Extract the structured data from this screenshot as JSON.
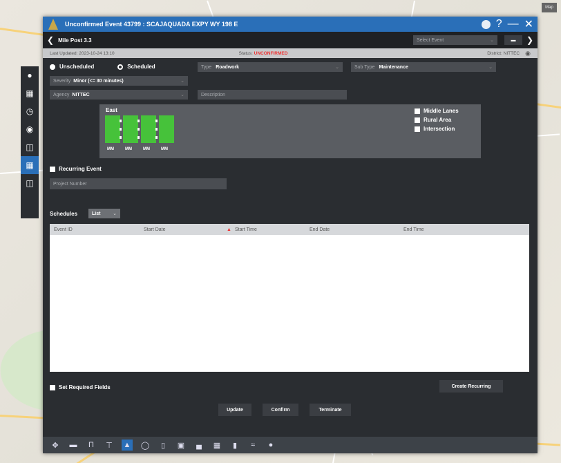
{
  "dialog": {
    "title": "Unconfirmed Event 43799 : SCAJAQUADA EXPY WY 198 E",
    "mile_post": "Mile Post 3.3",
    "select_event_placeholder": "Select Event"
  },
  "status": {
    "last_updated_label": "Last Updated: 2023-10-24 13:10",
    "status_label": "Status: ",
    "status_value": "UNCONFIRMED",
    "district": "District: NITTEC"
  },
  "form": {
    "unscheduled": "Unscheduled",
    "scheduled": "Scheduled",
    "type_label": "Type",
    "type_value": "Roadwork",
    "subtype_label": "Sub Type",
    "subtype_value": "Maintenance",
    "severity_label": "Severity",
    "severity_value": "Minor (<= 30 minutes)",
    "agency_label": "Agency",
    "agency_value": "NITTEC",
    "description_placeholder": "Description"
  },
  "lanes": {
    "direction": "East",
    "labels": [
      "MM",
      "MM",
      "MM",
      "MM"
    ],
    "options": [
      "Middle Lanes",
      "Rural Area",
      "Intersection"
    ]
  },
  "recurring": {
    "label": "Recurring Event",
    "project_placeholder": "Project Number"
  },
  "schedules": {
    "label": "Schedules",
    "list_label": "List",
    "columns": [
      "Event ID",
      "Start Date",
      "Start Time",
      "End Date",
      "End Time"
    ]
  },
  "bottom": {
    "set_required": "Set Required Fields",
    "create_recurring": "Create Recurring",
    "update": "Update",
    "confirm": "Confirm",
    "terminate": "Terminate"
  },
  "colors": {
    "accent": "#2a6fb8",
    "lane": "#46c23a",
    "unconfirmed": "#e33333",
    "dialog_bg": "#2a2d31"
  },
  "map_ctrl": "Map"
}
